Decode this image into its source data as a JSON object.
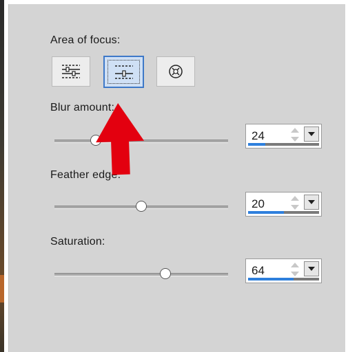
{
  "area_of_focus": {
    "label": "Area of focus:",
    "buttons": [
      {
        "name": "horizontal-band-focus-icon",
        "selected": false
      },
      {
        "name": "center-line-focus-icon",
        "selected": true
      },
      {
        "name": "elliptical-focus-icon",
        "selected": false
      }
    ]
  },
  "blur_amount": {
    "label": "Blur amount:",
    "value": "24",
    "fraction": 0.24
  },
  "feather_edge": {
    "label": "Feather edge:",
    "value": "20",
    "fraction": 0.5
  },
  "saturation": {
    "label": "Saturation:",
    "value": "64",
    "fraction": 0.64
  },
  "colors": {
    "panel": "#d4d4d4",
    "selected_border": "#3d78c8",
    "progress_fill": "#2e7fdc",
    "annotation_arrow": "#e3000f"
  },
  "annotation": {
    "icon": "red-up-arrow-icon"
  }
}
